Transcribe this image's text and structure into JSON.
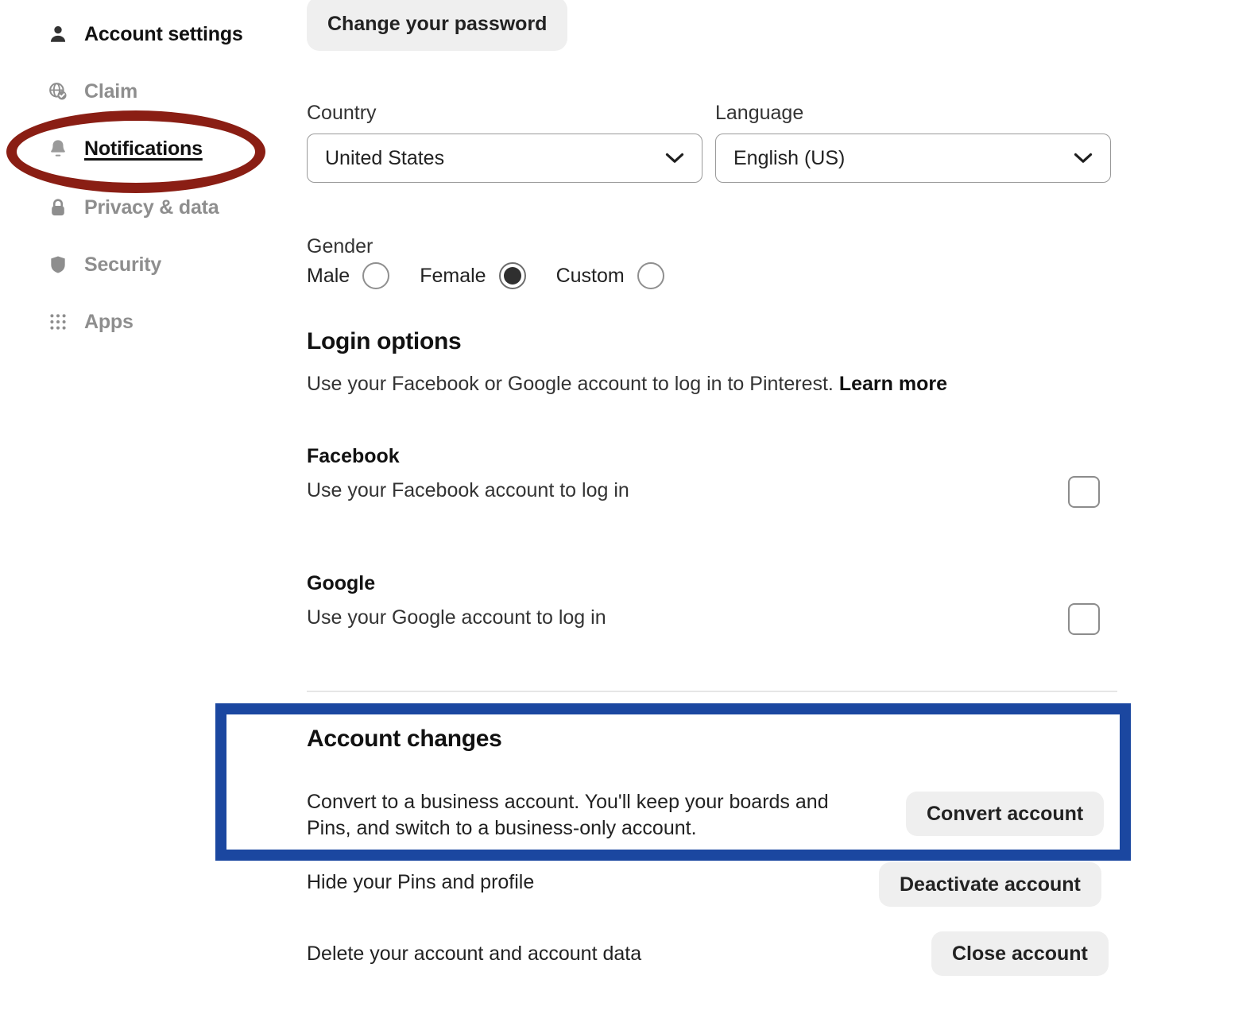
{
  "sidebar": {
    "items": [
      {
        "label": "Account settings",
        "icon": "person-icon",
        "state": "header"
      },
      {
        "label": "Claim",
        "icon": "globe-check-icon",
        "state": "muted"
      },
      {
        "label": "Notifications",
        "icon": "bell-icon",
        "state": "current"
      },
      {
        "label": "Privacy & data",
        "icon": "lock-icon",
        "state": "muted"
      },
      {
        "label": "Security",
        "icon": "shield-icon",
        "state": "muted"
      },
      {
        "label": "Apps",
        "icon": "grid-dots-icon",
        "state": "muted"
      }
    ]
  },
  "annotations": {
    "ellipse_color": "#8a1e14",
    "ellipse_target": "Notifications",
    "box_color": "#1b47a0",
    "box_target": "Account changes"
  },
  "main": {
    "change_password_label": "Change your password",
    "country": {
      "label": "Country",
      "value": "United States"
    },
    "language": {
      "label": "Language",
      "value": "English (US)"
    },
    "gender": {
      "label": "Gender",
      "options": [
        {
          "label": "Male",
          "checked": false
        },
        {
          "label": "Female",
          "checked": true
        },
        {
          "label": "Custom",
          "checked": false
        }
      ]
    },
    "login_options": {
      "title": "Login options",
      "description": "Use your Facebook or Google account to log in to Pinterest.",
      "learn_more": "Learn more",
      "providers": [
        {
          "name": "Facebook",
          "description": "Use your Facebook account to log in",
          "checked": false
        },
        {
          "name": "Google",
          "description": "Use your Google account to log in",
          "checked": false
        }
      ]
    },
    "account_changes": {
      "title": "Account changes",
      "rows": [
        {
          "description": "Convert to a business account. You'll keep your boards and Pins, and switch to a business-only account.",
          "button": "Convert account"
        },
        {
          "description": "Hide your Pins and profile",
          "button": "Deactivate account"
        },
        {
          "description": "Delete your account and account data",
          "button": "Close account"
        }
      ]
    }
  }
}
